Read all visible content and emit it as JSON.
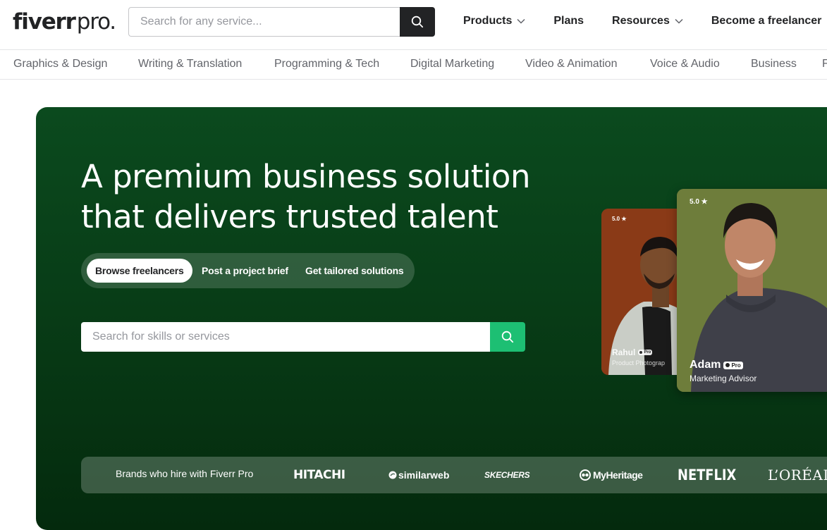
{
  "header": {
    "logo_brand": "fiverr",
    "logo_suffix": "pro.",
    "search_placeholder": "Search for any service...",
    "nav": [
      {
        "label": "Products",
        "dropdown": true
      },
      {
        "label": "Plans",
        "dropdown": false
      },
      {
        "label": "Resources",
        "dropdown": true
      },
      {
        "label": "Become a freelancer",
        "dropdown": false
      }
    ]
  },
  "categories": [
    "Graphics & Design",
    "Writing & Translation",
    "Programming & Tech",
    "Digital Marketing",
    "Video & Animation",
    "Voice & Audio",
    "Business",
    "F"
  ],
  "hero": {
    "headline_line1": "A premium business solution",
    "headline_line2": "that delivers trusted talent",
    "tabs": [
      "Browse freelancers",
      "Post a project brief",
      "Get tailored solutions"
    ],
    "active_tab": "Browse freelancers",
    "search_placeholder": "Search for skills or services",
    "cards": [
      {
        "rating": "5.0 ★",
        "name": "Rahul",
        "badge": "Pro",
        "role": "Product Photograp"
      },
      {
        "rating": "5.0 ★",
        "name": "Adam",
        "badge": "Pro",
        "role": "Marketing Advisor"
      }
    ]
  },
  "brands": {
    "label": "Brands who hire with Fiverr Pro",
    "logos": [
      "HITACHI",
      "similarweb",
      "SKECHERS",
      "MyHeritage",
      "NETFLIX",
      "L’ORÉAL"
    ]
  },
  "colors": {
    "hero_green": "#0b4a1e",
    "accent_green": "#1dbf73",
    "dark": "#222325",
    "muted_text": "#62646a"
  }
}
